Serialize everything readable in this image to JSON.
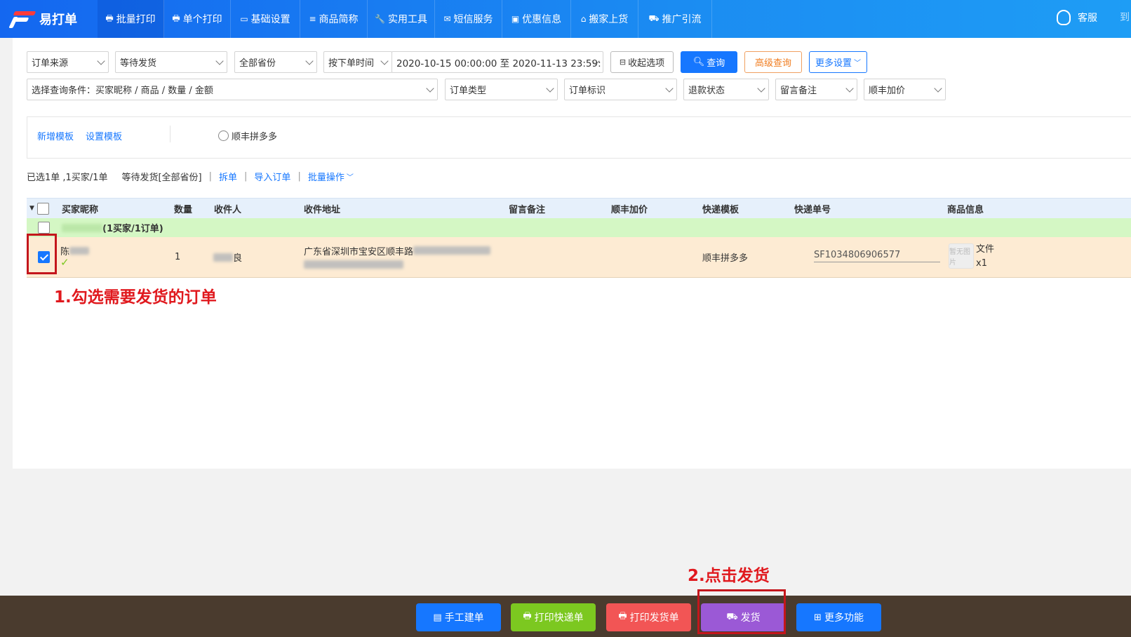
{
  "app": {
    "name": "易打单"
  },
  "nav": {
    "items": [
      {
        "label": "批量打印",
        "icon": "printer-icon",
        "active": true
      },
      {
        "label": "单个打印",
        "icon": "printer-icon"
      },
      {
        "label": "基础设置",
        "icon": "monitor-icon"
      },
      {
        "label": "商品简称",
        "icon": "list-icon"
      },
      {
        "label": "实用工具",
        "icon": "wrench-icon"
      },
      {
        "label": "短信服务",
        "icon": "mail-icon"
      },
      {
        "label": "优惠信息",
        "icon": "ticket-icon"
      },
      {
        "label": "搬家上货",
        "icon": "bag-icon"
      },
      {
        "label": "推广引流",
        "icon": "car-icon"
      }
    ],
    "service_label": "客服",
    "far_right_text": "到"
  },
  "filters": {
    "row1": {
      "order_source": "订单来源",
      "status": "等待发货",
      "province": "全部省份",
      "time_type": "按下单时间",
      "date_range": "2020-10-15 00:00:00 至 2020-11-13 23:59:",
      "collapse_label": "收起选项",
      "search_label": "查询",
      "advanced_label": "高级查询",
      "more_settings_label": "更多设置"
    },
    "row2": {
      "query_condition": "选择查询条件：买家昵称 / 商品 / 数量 / 金额",
      "order_type": "订单类型",
      "order_flag": "订单标识",
      "refund_status": "退款状态",
      "message_note": "留言备注",
      "sf_price": "顺丰加价"
    }
  },
  "templates": {
    "add_label": "新增模板",
    "settings_label": "设置模板",
    "option_label": "顺丰拼多多"
  },
  "summary": {
    "selected": "已选1单 ,1买家/1单",
    "status": "等待发货[全部省份]",
    "split_label": "拆单",
    "import_label": "导入订单",
    "batch_label": "批量操作"
  },
  "table": {
    "headers": [
      "买家昵称",
      "数量",
      "收件人",
      "收件地址",
      "留言备注",
      "顺丰加价",
      "快递模板",
      "快递单号",
      "商品信息"
    ],
    "group_label": "(1买家/1订单)",
    "row": {
      "buyer_visible": "陈",
      "quantity": "1",
      "recipient_visible": "良",
      "address_visible": "广东省深圳市宝安区顺丰路",
      "template": "顺丰拼多多",
      "tracking": "SF1034806906577",
      "product_name": "文件",
      "product_qty": "x1",
      "thumb_text": "暂无图片"
    }
  },
  "annotations": {
    "step1": "1.勾选需要发货的订单",
    "step2": "2.点击发货"
  },
  "footer": {
    "buttons": [
      {
        "label": "手工建单",
        "color": "#1677ff"
      },
      {
        "label": "打印快递单",
        "color": "#7cc820"
      },
      {
        "label": "打印发货单",
        "color": "#f25555"
      },
      {
        "label": "发货",
        "color": "#9b59d6"
      },
      {
        "label": "更多功能",
        "color": "#1677ff"
      }
    ]
  },
  "colors": {
    "nav_bg": "#1b8cf2",
    "primary": "#1677ff",
    "annotation_red": "#e0191e",
    "group_row_bg": "#d4f7c4",
    "data_row_bg": "#fdebd3",
    "footer_bg": "#4a3b2e"
  }
}
